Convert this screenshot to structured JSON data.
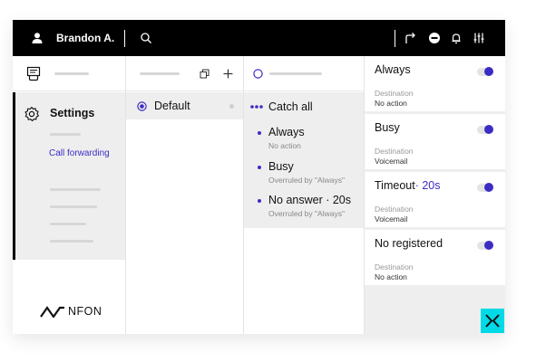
{
  "header": {
    "user_name": "Brandon A.",
    "icons": [
      "user-icon",
      "search-icon",
      "call-transfer-icon",
      "do-not-disturb-icon",
      "bell-icon",
      "sliders-icon"
    ]
  },
  "sidebar": {
    "section_label": "Settings",
    "active_link": "Call forwarding",
    "logo_text": "NFON"
  },
  "profiles": {
    "selected": "Default"
  },
  "rules": {
    "header": "Catch all",
    "items": [
      {
        "title": "Always",
        "subtitle": "No action"
      },
      {
        "title": "Busy",
        "subtitle": "Overruled by \"Always\""
      },
      {
        "title": "No answer · 20s",
        "subtitle": "Overruled by \"Always\""
      }
    ]
  },
  "detail_cards": [
    {
      "title": "Always",
      "extra": "",
      "dest_label": "Destination",
      "dest_value": "No action",
      "enabled": true
    },
    {
      "title": "Busy",
      "extra": "",
      "dest_label": "Destination",
      "dest_value": "Voicemail",
      "enabled": true
    },
    {
      "title": "Timeout",
      "extra": "· 20s",
      "dest_label": "Destination",
      "dest_value": "Voicemail",
      "enabled": true
    },
    {
      "title": "No registered",
      "extra": "",
      "dest_label": "Destination",
      "dest_value": "No action",
      "enabled": true
    }
  ],
  "colors": {
    "accent": "#3b2cc4",
    "topbar": "#000000",
    "panel_bg": "#eeeeee",
    "brand_cyan": "#00d9e6"
  }
}
